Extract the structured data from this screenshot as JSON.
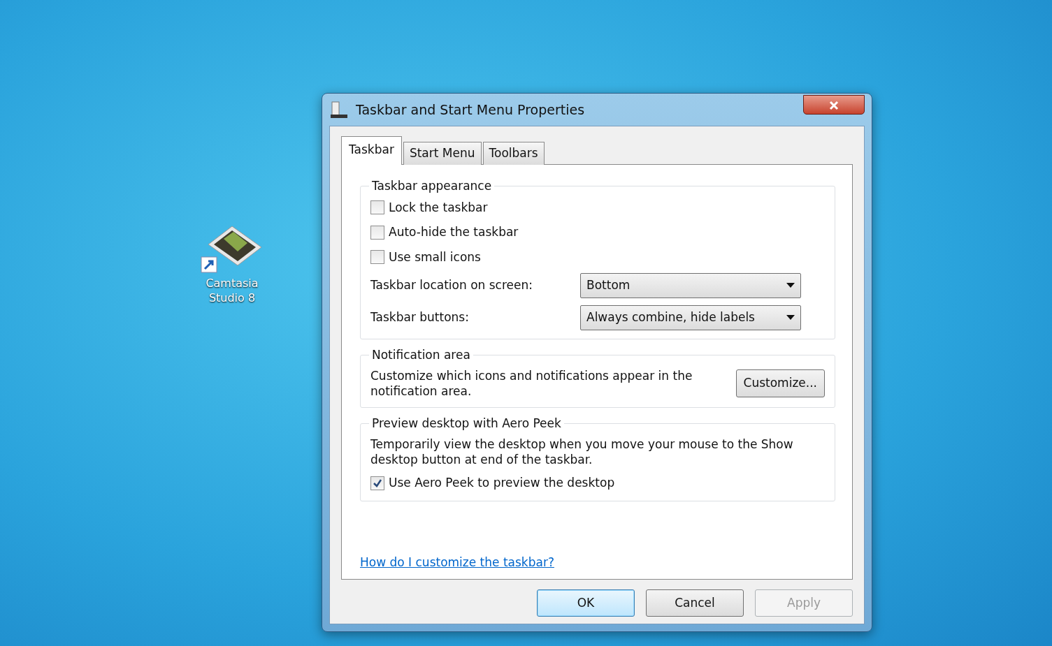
{
  "desktop": {
    "icons": [
      {
        "label": "Camtasia Studio 8"
      }
    ]
  },
  "window": {
    "title": "Taskbar and Start Menu Properties"
  },
  "tabs": [
    {
      "label": "Taskbar",
      "selected": true
    },
    {
      "label": "Start Menu",
      "selected": false
    },
    {
      "label": "Toolbars",
      "selected": false
    }
  ],
  "groups": [
    {
      "title": "Taskbar appearance",
      "items": [
        {
          "kind": "checkbox",
          "label": "Lock the taskbar",
          "checked": false
        },
        {
          "kind": "checkbox",
          "label": "Auto-hide the taskbar",
          "checked": false
        },
        {
          "kind": "checkbox",
          "label": "Use small icons",
          "checked": false
        },
        {
          "kind": "dropdown",
          "label": "Taskbar location on screen:",
          "value": "Bottom"
        },
        {
          "kind": "dropdown",
          "label": "Taskbar buttons:",
          "value": "Always combine, hide labels"
        }
      ]
    },
    {
      "title": "Notification area",
      "items": [
        {
          "kind": "text_button",
          "text": "Customize which icons and notifications appear in the notification area.",
          "button": "Customize..."
        }
      ]
    },
    {
      "title": "Preview desktop with Aero Peek",
      "items": [
        {
          "kind": "text",
          "text": "Temporarily view the desktop when you move your mouse to the Show desktop button at end of the taskbar."
        },
        {
          "kind": "checkbox",
          "label": "Use Aero Peek to preview the desktop",
          "checked": true
        }
      ]
    }
  ],
  "help_link": "How do I customize the taskbar?",
  "buttons": [
    {
      "label": "OK",
      "default": true,
      "disabled": false
    },
    {
      "label": "Cancel",
      "default": false,
      "disabled": false
    },
    {
      "label": "Apply",
      "default": false,
      "disabled": true
    }
  ]
}
